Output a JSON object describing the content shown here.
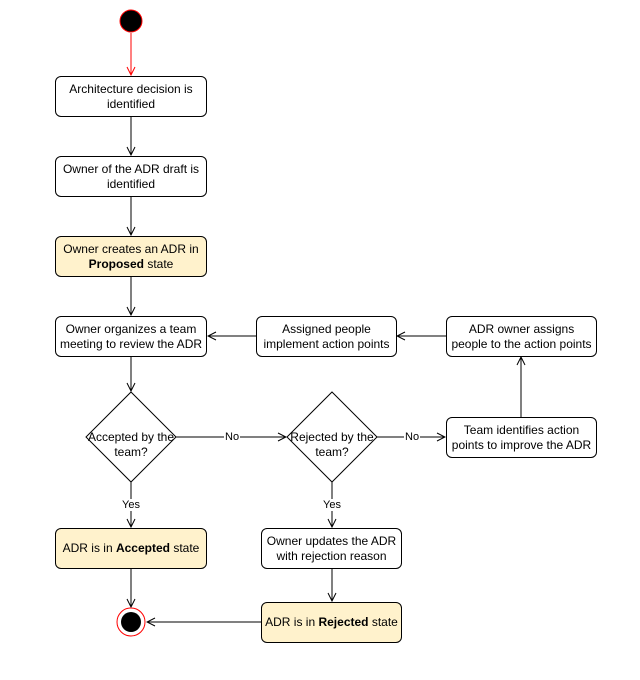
{
  "diagram": {
    "type": "activity",
    "colors": {
      "state_fill": "#fff2cc",
      "start_arrow": "#ff0000",
      "end_ring": "#ff0000"
    },
    "nodes": {
      "start": {
        "label": ""
      },
      "identified": {
        "label": "Architecture decision is identified"
      },
      "owner_identified": {
        "label": "Owner of the ADR draft is identified"
      },
      "proposed": {
        "label_pre": "Owner creates an ADR in ",
        "label_bold": "Proposed",
        "label_post": " state"
      },
      "review_meeting": {
        "label": "Owner organizes a team meeting to review the ADR"
      },
      "implement": {
        "label": "Assigned people implement action points"
      },
      "assign": {
        "label": "ADR owner assigns people to the action points"
      },
      "accepted_q": {
        "label": "Accepted by the team?"
      },
      "rejected_q": {
        "label": "Rejected by the team?"
      },
      "improve": {
        "label": "Team identifies action points to improve the ADR"
      },
      "accepted_state": {
        "label_pre": "ADR is in ",
        "label_bold": "Accepted",
        "label_post": " state"
      },
      "update_reason": {
        "label": "Owner updates the ADR with rejection reason"
      },
      "rejected_state": {
        "label_pre": "ADR is in ",
        "label_bold": "Rejected",
        "label_post": " state"
      },
      "end": {
        "label": ""
      }
    },
    "edge_labels": {
      "accepted_no": "No",
      "accepted_yes": "Yes",
      "rejected_no": "No",
      "rejected_yes": "Yes"
    }
  }
}
